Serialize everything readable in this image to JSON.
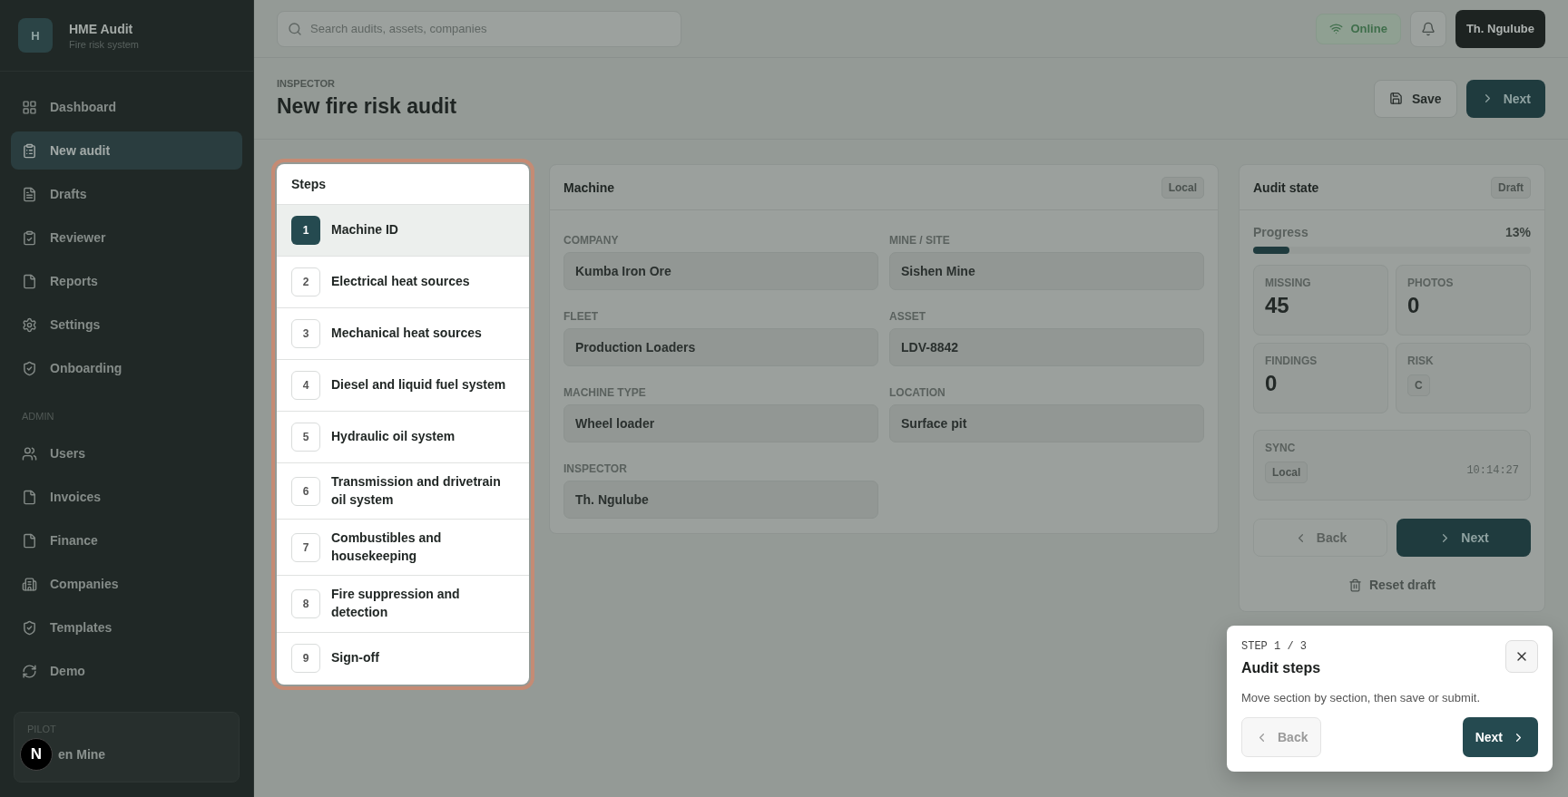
{
  "app": {
    "logo_letter": "H",
    "name": "HME Audit",
    "subtitle": "Fire risk system"
  },
  "sidebar": {
    "items": [
      {
        "label": "Dashboard",
        "selected": false
      },
      {
        "label": "New audit",
        "selected": true
      },
      {
        "label": "Drafts",
        "selected": false
      },
      {
        "label": "Reviewer",
        "selected": false
      },
      {
        "label": "Reports",
        "selected": false
      },
      {
        "label": "Settings",
        "selected": false
      },
      {
        "label": "Onboarding",
        "selected": false
      }
    ],
    "admin_heading": "ADMIN",
    "admin_items": [
      {
        "label": "Users",
        "selected": false
      },
      {
        "label": "Invoices",
        "selected": false
      },
      {
        "label": "Finance",
        "selected": false
      },
      {
        "label": "Companies",
        "selected": false
      },
      {
        "label": "Templates",
        "selected": false
      },
      {
        "label": "Demo",
        "selected": false
      }
    ],
    "footer": {
      "label": "PILOT",
      "value": "en Mine",
      "badge": "N"
    }
  },
  "topbar": {
    "search": {
      "placeholder": "Search audits, assets, companies"
    },
    "status": "Online",
    "user": "Th. Ngulube"
  },
  "header": {
    "eyebrow": "INSPECTOR",
    "title": "New fire risk audit",
    "save": "Save",
    "next": "Next"
  },
  "steps": {
    "title": "Steps",
    "items": [
      {
        "number": "1",
        "label": "Machine ID",
        "selected": true
      },
      {
        "number": "2",
        "label": "Electrical heat sources",
        "selected": false
      },
      {
        "number": "3",
        "label": "Mechanical heat sources",
        "selected": false
      },
      {
        "number": "4",
        "label": "Diesel and liquid fuel system",
        "selected": false
      },
      {
        "number": "5",
        "label": "Hydraulic oil system",
        "selected": false
      },
      {
        "number": "6",
        "label": "Transmission and drivetrain oil system",
        "selected": false
      },
      {
        "number": "7",
        "label": "Combustibles and housekeeping",
        "selected": false
      },
      {
        "number": "8",
        "label": "Fire suppression and detection",
        "selected": false
      },
      {
        "number": "9",
        "label": "Sign-off",
        "selected": false
      }
    ]
  },
  "machine": {
    "title": "Machine",
    "badge": "Local",
    "fields": [
      {
        "label": "COMPANY",
        "value": "Kumba Iron Ore"
      },
      {
        "label": "MINE / SITE",
        "value": "Sishen Mine"
      },
      {
        "label": "FLEET",
        "value": "Production Loaders"
      },
      {
        "label": "ASSET",
        "value": "LDV-8842"
      },
      {
        "label": "MACHINE TYPE",
        "value": "Wheel loader"
      },
      {
        "label": "LOCATION",
        "value": "Surface pit"
      },
      {
        "label": "INSPECTOR",
        "value": "Th. Ngulube"
      }
    ]
  },
  "audit_state": {
    "title": "Audit state",
    "badge": "Draft",
    "progress": {
      "label": "Progress",
      "reading": "13%",
      "level": 0.13
    },
    "stats": [
      {
        "label": "MISSING",
        "value": "45",
        "kind": "number"
      },
      {
        "label": "PHOTOS",
        "value": "0",
        "kind": "number"
      },
      {
        "label": "FINDINGS",
        "value": "0",
        "kind": "number"
      },
      {
        "label": "RISK",
        "value": "C",
        "kind": "badge"
      }
    ],
    "sync": {
      "label": "SYNC",
      "badge": "Local",
      "time": "10:14:27"
    },
    "back": {
      "label": "Back",
      "disabled": true
    },
    "next": {
      "label": "Next",
      "disabled": false
    },
    "reset": "Reset draft"
  },
  "tour": {
    "step": "STEP 1 / 3",
    "title": "Audit steps",
    "text": "Move section by section, then save or submit.",
    "back": {
      "label": "Back",
      "disabled": true
    },
    "next": {
      "label": "Next",
      "disabled": false
    }
  }
}
